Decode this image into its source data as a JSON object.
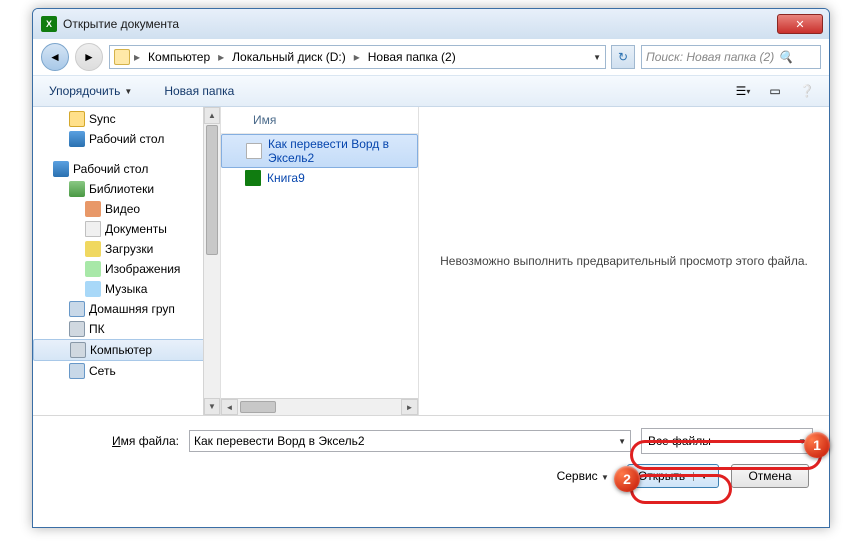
{
  "title": "Открытие документа",
  "path": {
    "segments": [
      "Компьютер",
      "Локальный диск (D:)",
      "Новая папка (2)"
    ]
  },
  "search_placeholder": "Поиск: Новая папка (2)",
  "toolbar": {
    "organize": "Упорядочить",
    "new_folder": "Новая папка"
  },
  "tree": [
    {
      "label": "Sync",
      "icon": "ic-folder",
      "lvl": 2
    },
    {
      "label": "Рабочий стол",
      "icon": "ic-desktop",
      "lvl": 2
    },
    {
      "spacer": true
    },
    {
      "label": "Рабочий стол",
      "icon": "ic-desktop",
      "lvl": 1
    },
    {
      "label": "Библиотеки",
      "icon": "ic-lib",
      "lvl": 2
    },
    {
      "label": "Видео",
      "icon": "ic-video",
      "lvl": 2,
      "sub": true
    },
    {
      "label": "Документы",
      "icon": "ic-doc",
      "lvl": 2,
      "sub": true
    },
    {
      "label": "Загрузки",
      "icon": "ic-dl",
      "lvl": 2,
      "sub": true
    },
    {
      "label": "Изображения",
      "icon": "ic-img",
      "lvl": 2,
      "sub": true
    },
    {
      "label": "Музыка",
      "icon": "ic-music",
      "lvl": 2,
      "sub": true
    },
    {
      "label": "Домашняя груп",
      "icon": "ic-net",
      "lvl": 2
    },
    {
      "label": "ПК",
      "icon": "ic-comp",
      "lvl": 2
    },
    {
      "label": "Компьютер",
      "icon": "ic-comp",
      "lvl": 2,
      "sel": true
    },
    {
      "label": "Сеть",
      "icon": "ic-net",
      "lvl": 2
    }
  ],
  "files_header": "Имя",
  "files": [
    {
      "name": "Как перевести Ворд в Эксель2",
      "icon": "fic-txt",
      "sel": true
    },
    {
      "name": "Книга9",
      "icon": "fic-xls"
    }
  ],
  "preview_msg": "Невозможно выполнить предварительный просмотр этого файла.",
  "footer": {
    "filename_label_u": "И",
    "filename_label_rest": "мя файла:",
    "filename_value": "Как перевести Ворд в Эксель2",
    "filetype_value": "Все файлы",
    "service": "Сервис",
    "open": "Открыть",
    "cancel": "Отмена"
  },
  "badges": {
    "one": "1",
    "two": "2"
  }
}
